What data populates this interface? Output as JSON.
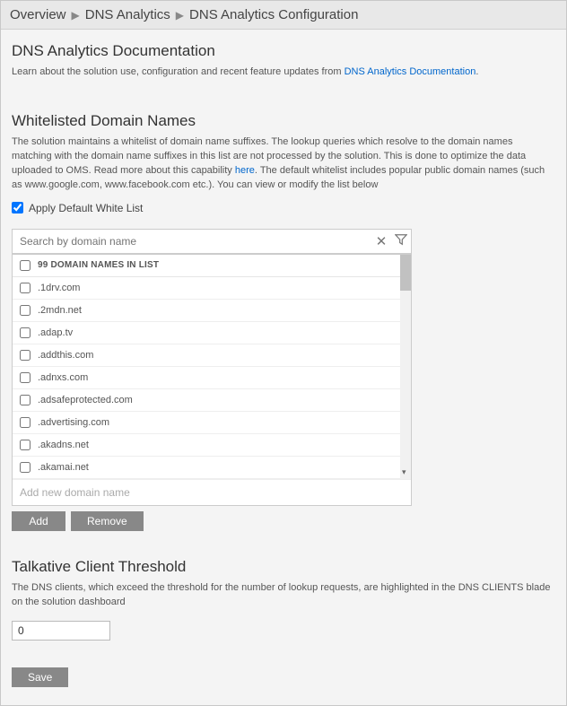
{
  "breadcrumb": {
    "item0": "Overview",
    "item1": "DNS Analytics",
    "item2": "DNS Analytics Configuration"
  },
  "doc": {
    "title": "DNS Analytics Documentation",
    "desc_pre": "Learn about the solution use, configuration and recent feature updates from ",
    "link": "DNS Analytics Documentation"
  },
  "whitelist": {
    "title": "Whitelisted Domain Names",
    "desc_pre": "The solution maintains a whitelist of domain name suffixes. The lookup queries which resolve to the domain names matching with the domain name suffixes in this list are not processed by the solution. This is done to optimize the data uploaded to OMS. Read more about this capability ",
    "link": "here",
    "desc_post": ". The default whitelist includes popular public domain names (such as www.google.com, www.facebook.com etc.). You can view or modify the list below",
    "apply_default": "Apply Default White List",
    "search_placeholder": "Search by domain name",
    "list_header": "99 DOMAIN NAMES IN LIST",
    "items": {
      "i0": ".1drv.com",
      "i1": ".2mdn.net",
      "i2": ".adap.tv",
      "i3": ".addthis.com",
      "i4": ".adnxs.com",
      "i5": ".adsafeprotected.com",
      "i6": ".advertising.com",
      "i7": ".akadns.net",
      "i8": ".akamai.net"
    },
    "add_placeholder": "Add new domain name",
    "add_btn": "Add",
    "remove_btn": "Remove"
  },
  "threshold": {
    "title": "Talkative Client Threshold",
    "desc": "The DNS clients, which exceed the threshold for the number of lookup requests, are highlighted in the DNS CLIENTS blade on the solution dashboard",
    "value": "0"
  },
  "save_btn": "Save"
}
